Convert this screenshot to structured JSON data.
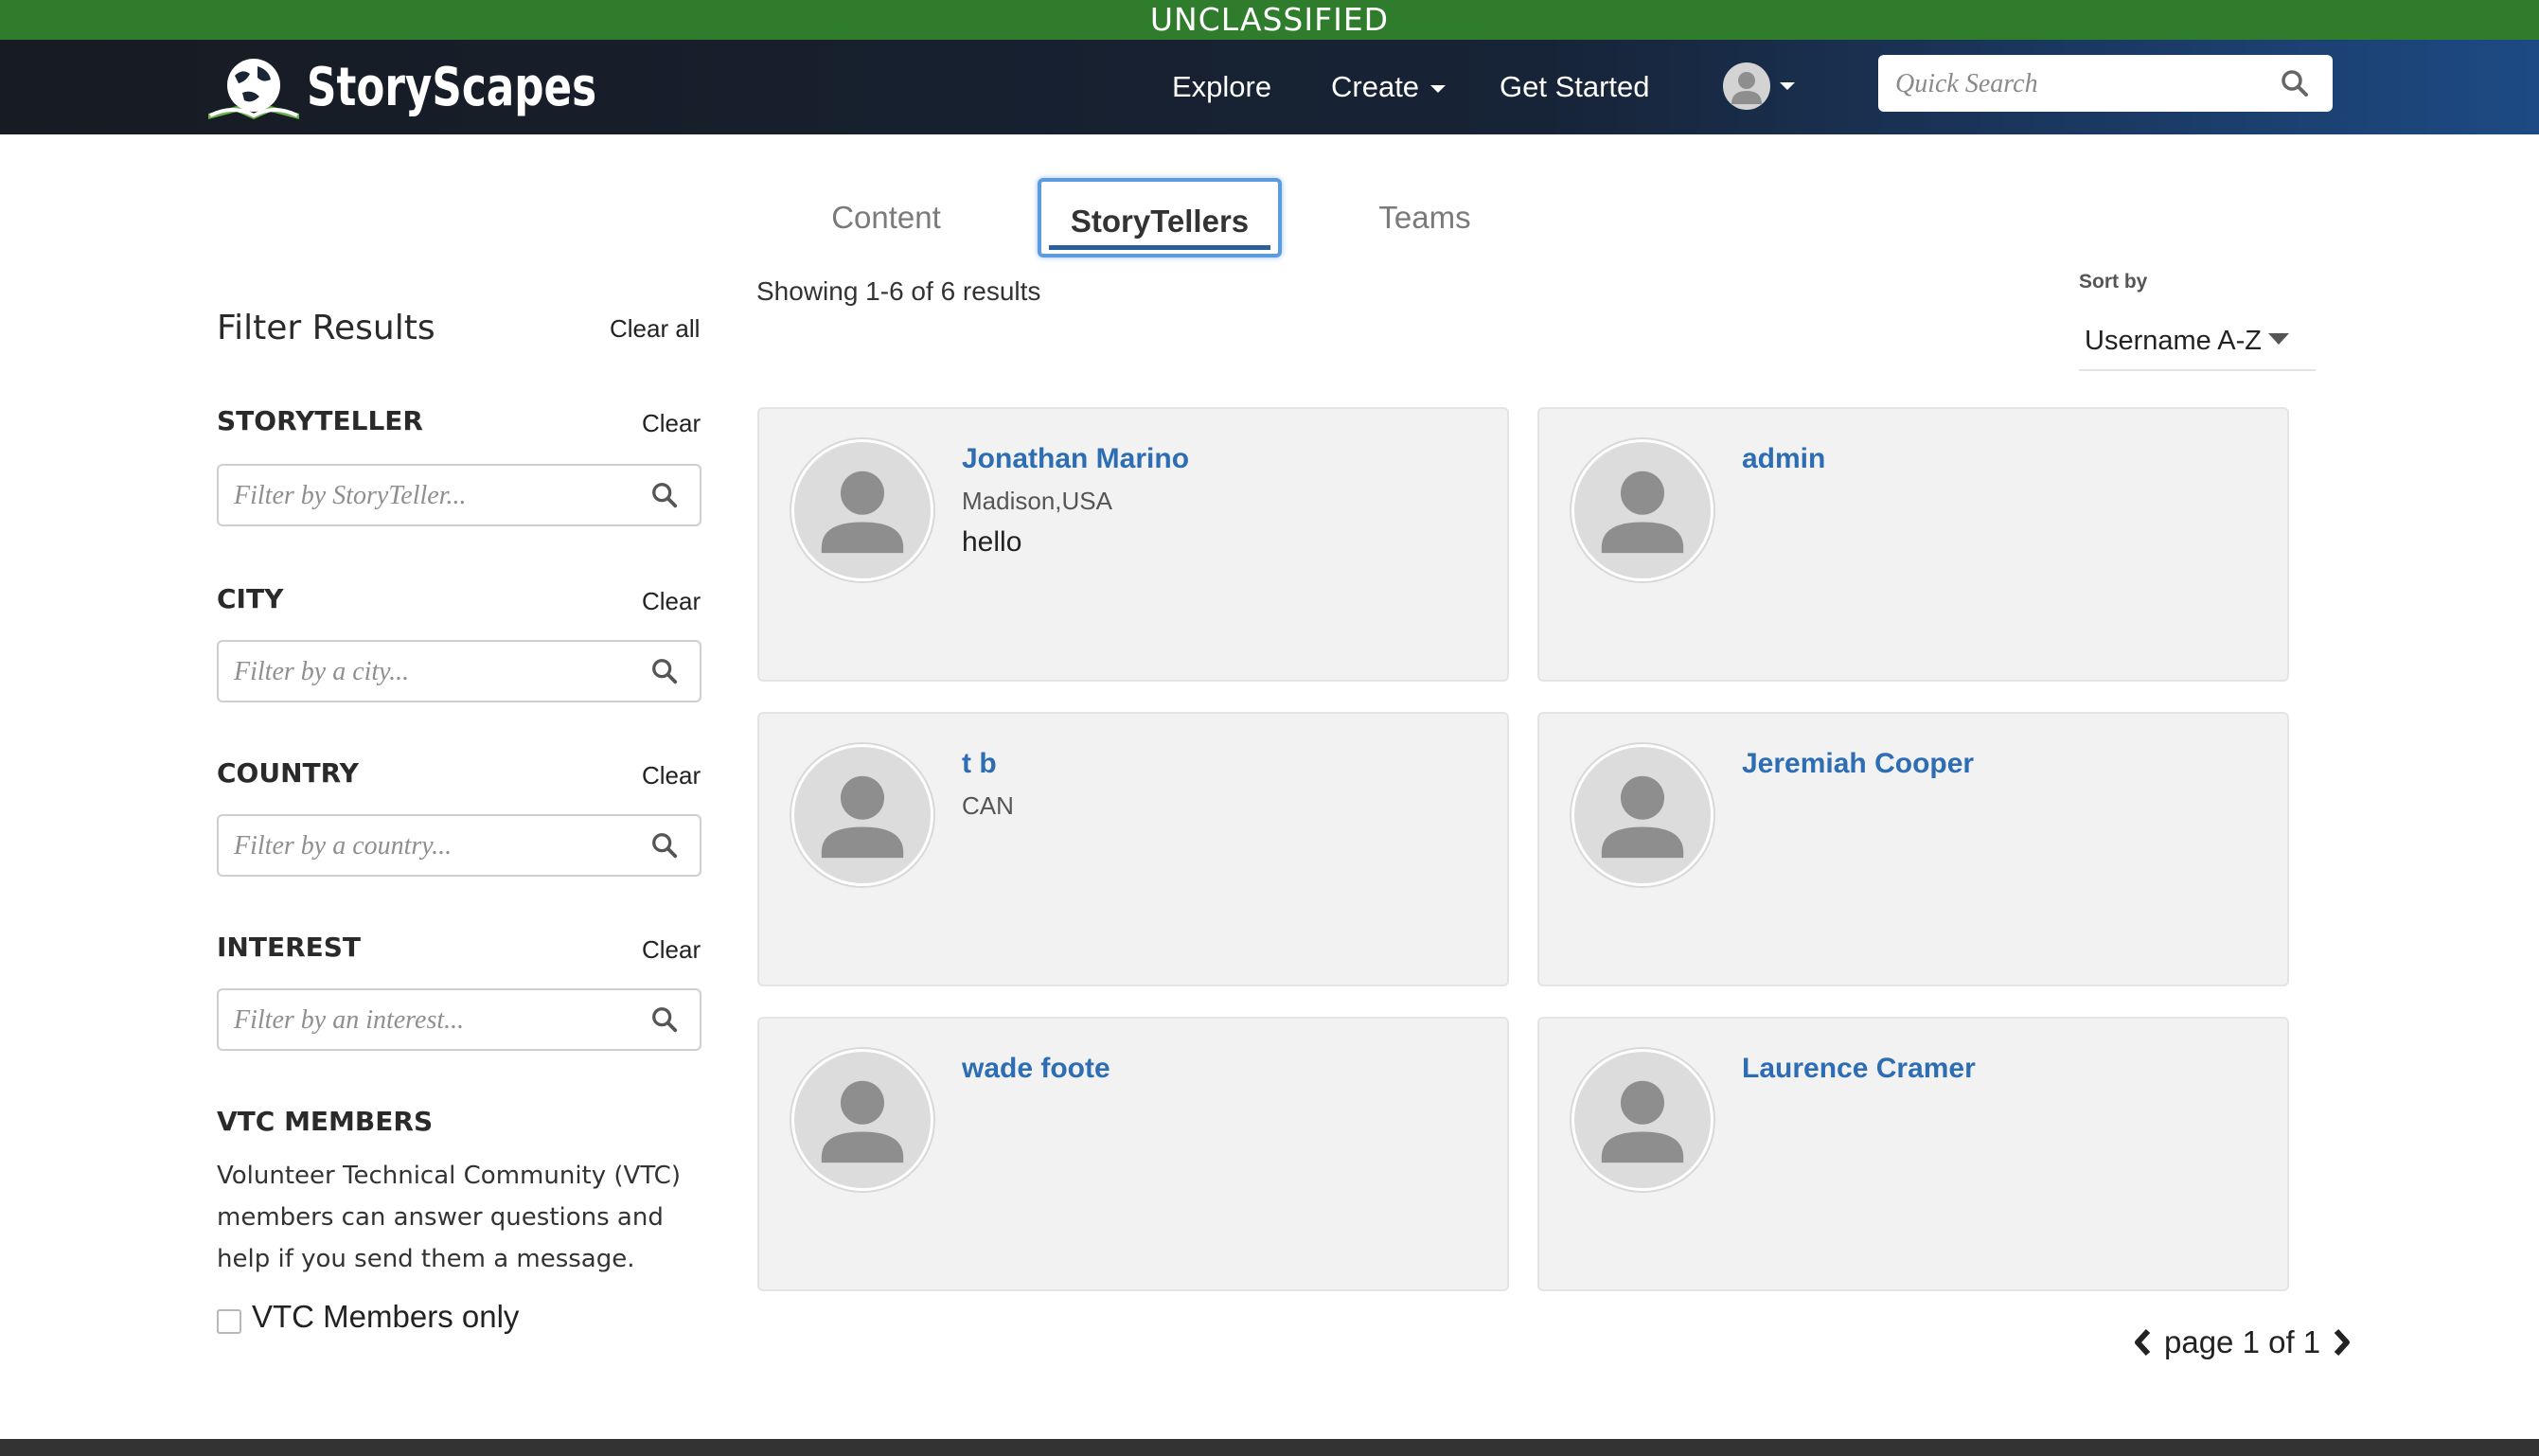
{
  "banner": {
    "text": "UNCLASSIFIED"
  },
  "header": {
    "logo_text": "StoryScapes",
    "nav": [
      {
        "label": "Explore"
      },
      {
        "label": "Create"
      },
      {
        "label": "Get Started"
      }
    ],
    "search": {
      "placeholder": "Quick Search",
      "value": ""
    }
  },
  "tabs": [
    {
      "label": "Content",
      "active": false
    },
    {
      "label": "StoryTellers",
      "active": true
    },
    {
      "label": "Teams",
      "active": false
    }
  ],
  "results": {
    "summary": "Showing 1-6 of 6 results",
    "sort_label": "Sort by",
    "sort_value": "Username A-Z"
  },
  "sidebar": {
    "title": "Filter Results",
    "clear_all": "Clear all",
    "filters": [
      {
        "label": "STORYTELLER",
        "clear": "Clear",
        "placeholder": "Filter by StoryTeller...",
        "value": ""
      },
      {
        "label": "CITY",
        "clear": "Clear",
        "placeholder": "Filter by a city...",
        "value": ""
      },
      {
        "label": "COUNTRY",
        "clear": "Clear",
        "placeholder": "Filter by a country...",
        "value": ""
      },
      {
        "label": "INTEREST",
        "clear": "Clear",
        "placeholder": "Filter by an interest...",
        "value": ""
      }
    ],
    "vtc": {
      "label": "VTC MEMBERS",
      "description": "Volunteer Technical Community (VTC) members can answer questions and help if you send them a message.",
      "checkbox_label": "VTC Members only",
      "checked": false
    }
  },
  "storytellers": [
    {
      "name": "Jonathan Marino",
      "location": "Madison,USA",
      "bio": "hello"
    },
    {
      "name": "admin",
      "location": "",
      "bio": ""
    },
    {
      "name": "t b",
      "location": "CAN",
      "bio": ""
    },
    {
      "name": "Jeremiah Cooper",
      "location": "",
      "bio": ""
    },
    {
      "name": "wade foote",
      "location": "",
      "bio": ""
    },
    {
      "name": "Laurence Cramer",
      "location": "",
      "bio": ""
    }
  ],
  "pagination": {
    "text": "page 1 of 1"
  },
  "colors": {
    "banner": "#2f7d2c",
    "navbar_dark": "#171b22",
    "navbar_blue": "#1d4a84",
    "link": "#2d6db3",
    "active_tab_outline": "#5b9be0",
    "card_background": "#f2f2f2",
    "footer": "#333333"
  },
  "icons": {
    "logo": "globe-book-logo-icon",
    "search": "magnifier-icon",
    "avatar": "person-silhouette-icon",
    "dropdown": "caret-down-icon",
    "prev": "chevron-left-icon",
    "next": "chevron-right-icon"
  }
}
